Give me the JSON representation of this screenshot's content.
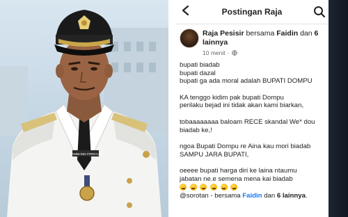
{
  "photo": {
    "name_tag": "BAMBANG FIRDAUS"
  },
  "topbar": {
    "title": "Postingan Raja",
    "back_icon": "chevron-left-icon",
    "search_icon": "search-icon"
  },
  "post": {
    "author": "Raja Pesisir",
    "with_word": "bersama",
    "tagged": "Faidin",
    "and_word": "dan",
    "others": "6 lainnya",
    "time": "10 menit",
    "dot": "·",
    "lines": [
      [
        "bupati biadab",
        "bupati dazal",
        "bupati ga ada moral adalah BUPATI DOMPU"
      ],
      [
        "KA tenggo kidim pak bupati Dompu",
        "perilaku bejad ini tidak akan kami biarkan,"
      ],
      [
        "tobaaaaaaaa baloam RECE skandal We* dou",
        "biadab ke,!"
      ],
      [
        "ngoa Bupati Dompu re Aina kau mori biadab",
        "SAMPU JARA BUPATI,"
      ],
      [
        "oeeee bupati harga diri ke laina ntaumu",
        "jabatan ne.e semena mena kai biadab"
      ]
    ],
    "emoji_count": 6,
    "footer_mention": "@sorotan",
    "footer_sep": " - bersama ",
    "footer_tagged": "Faidin",
    "footer_and": " dan ",
    "footer_others": "6 lainnya",
    "footer_end": "."
  },
  "colors": {
    "link_blue": "#1877f2",
    "text": "#1c1e21",
    "muted": "#65676b"
  }
}
